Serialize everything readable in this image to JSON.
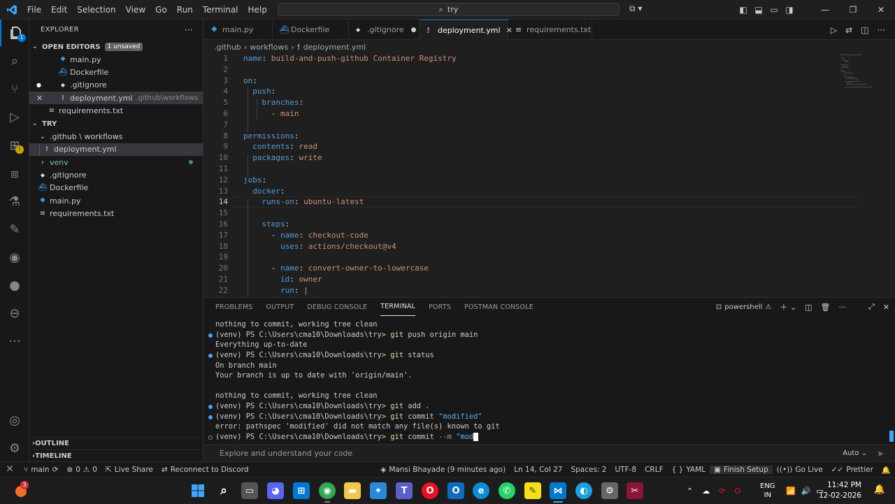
{
  "titlebar": {
    "menu": [
      "File",
      "Edit",
      "Selection",
      "View",
      "Go",
      "Run",
      "Terminal",
      "Help"
    ],
    "search": "try"
  },
  "explorer": {
    "header": "EXPLORER",
    "open_editors_label": "OPEN EDITORS",
    "unsaved_badge": "1 unsaved",
    "open_editors": [
      {
        "name": "main.py",
        "icon": "python-icon",
        "desc": ""
      },
      {
        "name": "Dockerfile",
        "icon": "docker-icon",
        "desc": ""
      },
      {
        "name": ".gitignore",
        "icon": "git-icon",
        "desc": ""
      },
      {
        "name": "deployment.yml",
        "icon": "yaml-icon",
        "desc": ".github\\workflows"
      },
      {
        "name": "requirements.txt",
        "icon": "text-icon",
        "desc": ""
      }
    ],
    "folder_label": "TRY",
    "tree": [
      {
        "name": ".github \\ workflows"
      },
      {
        "name": "deployment.yml"
      },
      {
        "name": "venv"
      },
      {
        "name": ".gitignore"
      },
      {
        "name": "Dockerfile"
      },
      {
        "name": "main.py"
      },
      {
        "name": "requirements.txt"
      }
    ],
    "outline_label": "OUTLINE",
    "timeline_label": "TIMELINE"
  },
  "tabs": [
    {
      "label": "main.py",
      "icon": "python-icon"
    },
    {
      "label": "Dockerfile",
      "icon": "docker-icon"
    },
    {
      "label": ".gitignore",
      "icon": "git-icon"
    },
    {
      "label": "deployment.yml",
      "icon": "yaml-icon"
    },
    {
      "label": "requirements.txt",
      "icon": "text-icon"
    }
  ],
  "breadcrumb": [
    ".github",
    "workflows",
    "deployment.yml"
  ],
  "editor": {
    "current_line": 14,
    "lines": [
      {
        "n": "1",
        "text": "name: build-and-push-github Container Registry"
      },
      {
        "n": "2",
        "text": ""
      },
      {
        "n": "3",
        "text": "on:"
      },
      {
        "n": "4",
        "text": "  push:"
      },
      {
        "n": "5",
        "text": "    branches:"
      },
      {
        "n": "6",
        "text": "      - main"
      },
      {
        "n": "7",
        "text": ""
      },
      {
        "n": "8",
        "text": "permissions:"
      },
      {
        "n": "9",
        "text": "  contents: read"
      },
      {
        "n": "10",
        "text": "  packages: write"
      },
      {
        "n": "11",
        "text": ""
      },
      {
        "n": "12",
        "text": "jobs:"
      },
      {
        "n": "13",
        "text": "  docker:"
      },
      {
        "n": "14",
        "text": "    runs-on: ubuntu-latest"
      },
      {
        "n": "15",
        "text": ""
      },
      {
        "n": "16",
        "text": "    steps:"
      },
      {
        "n": "17",
        "text": "      - name: checkout-code"
      },
      {
        "n": "18",
        "text": "        uses: actions/checkout@v4"
      },
      {
        "n": "19",
        "text": ""
      },
      {
        "n": "20",
        "text": "      - name: convert-owner-to-lowercase"
      },
      {
        "n": "21",
        "text": "        id: owner"
      },
      {
        "n": "22",
        "text": "        run: |"
      }
    ]
  },
  "panel": {
    "tabs": [
      "PROBLEMS",
      "OUTPUT",
      "DEBUG CONSOLE",
      "TERMINAL",
      "PORTS",
      "POSTMAN CONSOLE"
    ],
    "active_tab": "TERMINAL",
    "shell": "powershell",
    "terminal_lines": [
      {
        "type": "out",
        "text": "nothing to commit, working tree clean"
      },
      {
        "type": "cmd",
        "prompt": "(venv) PS C:\\Users\\cma10\\Downloads\\try> ",
        "cmd": "git",
        "args": " push origin main"
      },
      {
        "type": "out",
        "text": "Everything up-to-date"
      },
      {
        "type": "cmd",
        "prompt": "(venv) PS C:\\Users\\cma10\\Downloads\\try> ",
        "cmd": "git",
        "args": " status"
      },
      {
        "type": "out",
        "text": "On branch main"
      },
      {
        "type": "out",
        "text": "Your branch is up to date with 'origin/main'."
      },
      {
        "type": "out",
        "text": ""
      },
      {
        "type": "out",
        "text": "nothing to commit, working tree clean"
      },
      {
        "type": "cmd",
        "prompt": "(venv) PS C:\\Users\\cma10\\Downloads\\try> ",
        "cmd": "git",
        "args": " add ."
      },
      {
        "type": "cmd2",
        "prompt": "(venv) PS C:\\Users\\cma10\\Downloads\\try> ",
        "cmd": "git",
        "args": " commit ",
        "str": "\"modified\""
      },
      {
        "type": "out",
        "text": "error: pathspec 'modified' did not match any file(s) known to git"
      },
      {
        "type": "cmd3",
        "prompt": "(venv) PS C:\\Users\\cma10\\Downloads\\try> ",
        "cmd": "git",
        "args": " commit ",
        "flag": "--m ",
        "str": "\"mod"
      }
    ]
  },
  "ask": {
    "placeholder": "Explore and understand your code",
    "mode": "Auto"
  },
  "statusbar": {
    "branch": "main",
    "errors": "0",
    "warnings": "0",
    "liveshare": "Live Share",
    "discord": "Reconnect to Discord",
    "blame": "Mansi Bhayade (9 minutes ago)",
    "position": "Ln 14, Col 27",
    "spaces": "Spaces: 2",
    "encoding": "UTF-8",
    "eol": "CRLF",
    "language": "YAML",
    "finish_setup": "Finish Setup",
    "golive": "Go Live",
    "prettier": "Prettier"
  },
  "taskbar": {
    "lang1": "ENG",
    "lang2": "IN",
    "time": "11:42 PM",
    "date": "12-02-2026",
    "notif_count": "3"
  },
  "colors": {
    "accent": "#0078d4",
    "keyword": "#569cd6",
    "string": "#ce9178"
  }
}
